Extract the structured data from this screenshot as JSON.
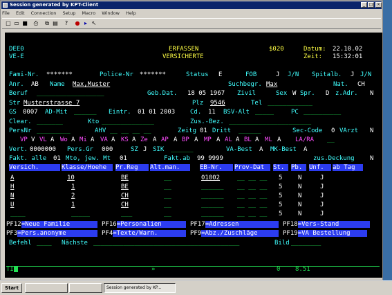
{
  "window": {
    "title": "Session generated by KPT-Client"
  },
  "menu": [
    "File",
    "Edit",
    "Connection",
    "Setup",
    "Macro",
    "Window",
    "Help"
  ],
  "toolbar": [
    "new-icon",
    "open-icon",
    "save-icon",
    "print-icon",
    "copy-icon",
    "paste-icon",
    "help-icon",
    "record-icon",
    "play-icon",
    "context-help-icon"
  ],
  "terminal": {
    "header": {
      "screen_id": "DEE0",
      "sub_id": "VE-E",
      "title1": "ERFASSEN",
      "title2": "VERSICHERTE",
      "code": "$020",
      "datum_label": "Datum:",
      "datum": "22.10.02",
      "zeit_label": "Zeit:",
      "zeit": "15:32:01"
    },
    "rows": {
      "r1": [
        "Fami-Nr.",
        "*******",
        "Police-Nr",
        "*******",
        "Status",
        "E",
        "FOB",
        "J",
        "J/N",
        "Spitalb.",
        "J",
        "J/N"
      ],
      "r2": [
        "Anr.",
        "AB",
        "Name",
        "Max,Muster",
        "Suchbegr.",
        "Max",
        "Nat.",
        "CH"
      ],
      "r3": [
        "Beruf",
        "Geb.Dat.",
        "18 05 1967",
        "Zivil",
        "Sex",
        "W",
        "Spr.",
        "D",
        "z.Adr.",
        "N"
      ],
      "r4": [
        "Str",
        "Musterstrasse 7",
        "Plz",
        "9546",
        "Tel"
      ],
      "r5": [
        "GS",
        "0007",
        "AD-Mit",
        "Eintr.",
        "01 01 2003",
        "Cd.",
        "11",
        "BSV-Alt",
        "PC"
      ],
      "r6": [
        "Clear.",
        "Kto",
        "Zus.-Bez."
      ],
      "r7": [
        "PersNr",
        "AHV",
        "Zeitg",
        "01",
        "Dritt",
        "Sec-Code",
        "0",
        "VArzt",
        "N"
      ],
      "r8": [
        "VP",
        "V",
        "VL",
        "A",
        "Wo",
        "A",
        "Mi",
        "A",
        "VA",
        "A",
        "KS",
        "A",
        "Ze",
        "A",
        "AP",
        "A",
        "BP",
        "A",
        "MP",
        "A",
        "AL",
        "A",
        "BL",
        "A",
        "ML",
        "A",
        "LA/RA"
      ],
      "r9": [
        "Vert.",
        "0000000",
        "Pers.Gr",
        "000",
        "SZ",
        "J",
        "SIK",
        "VA-Best",
        "A",
        "MK-Best",
        "A"
      ],
      "r10": [
        "Fakt. alle",
        "01",
        "Mto, jew. Mt",
        "01",
        "Fakt.ab",
        "99 9999",
        "zus.Deckung",
        "N"
      ]
    },
    "table": {
      "headers": [
        "Versich.",
        "Klasse/Hoehe",
        "Pr.Reg",
        "Alt.man.",
        "EB-Nr.",
        "Prov-Dat",
        "St.",
        "Pb.",
        "Unf.",
        "ab Tag"
      ],
      "rows": [
        [
          "A",
          "10",
          "BE",
          "01002",
          "5",
          "N",
          "J"
        ],
        [
          "H",
          "1",
          "BE",
          "",
          "5",
          "N",
          "J"
        ],
        [
          "N",
          "2",
          "CH",
          "",
          "5",
          "N",
          "J"
        ],
        [
          "U",
          "1",
          "CH",
          "",
          "5",
          "N",
          "J"
        ],
        [
          "",
          "",
          "",
          "",
          "5",
          "N",
          "J"
        ]
      ]
    },
    "pfkeys": [
      [
        "PF12",
        "=Neue Familie"
      ],
      [
        "PF16",
        "=Personalien"
      ],
      [
        "PF17",
        "=Adressen"
      ],
      [
        "PF18",
        "=Vers-Stand"
      ],
      [
        "PF3",
        "=Pers.anonyme"
      ],
      [
        "PF4",
        "=Texte/Warn."
      ],
      [
        "PF9",
        "=Abz./Zuschläge"
      ],
      [
        "PF19",
        "=VA Bestellung"
      ]
    ],
    "cmd": {
      "befehl": "Befehl",
      "naechste": "Nächste",
      "bild": "Bild"
    },
    "status": {
      "ti": "TI",
      "arrows": "»",
      "a": "0",
      "b": "8.51"
    }
  },
  "taskbar": {
    "start": "Start",
    "items": [
      "",
      "",
      "Session generated by KP..."
    ]
  }
}
